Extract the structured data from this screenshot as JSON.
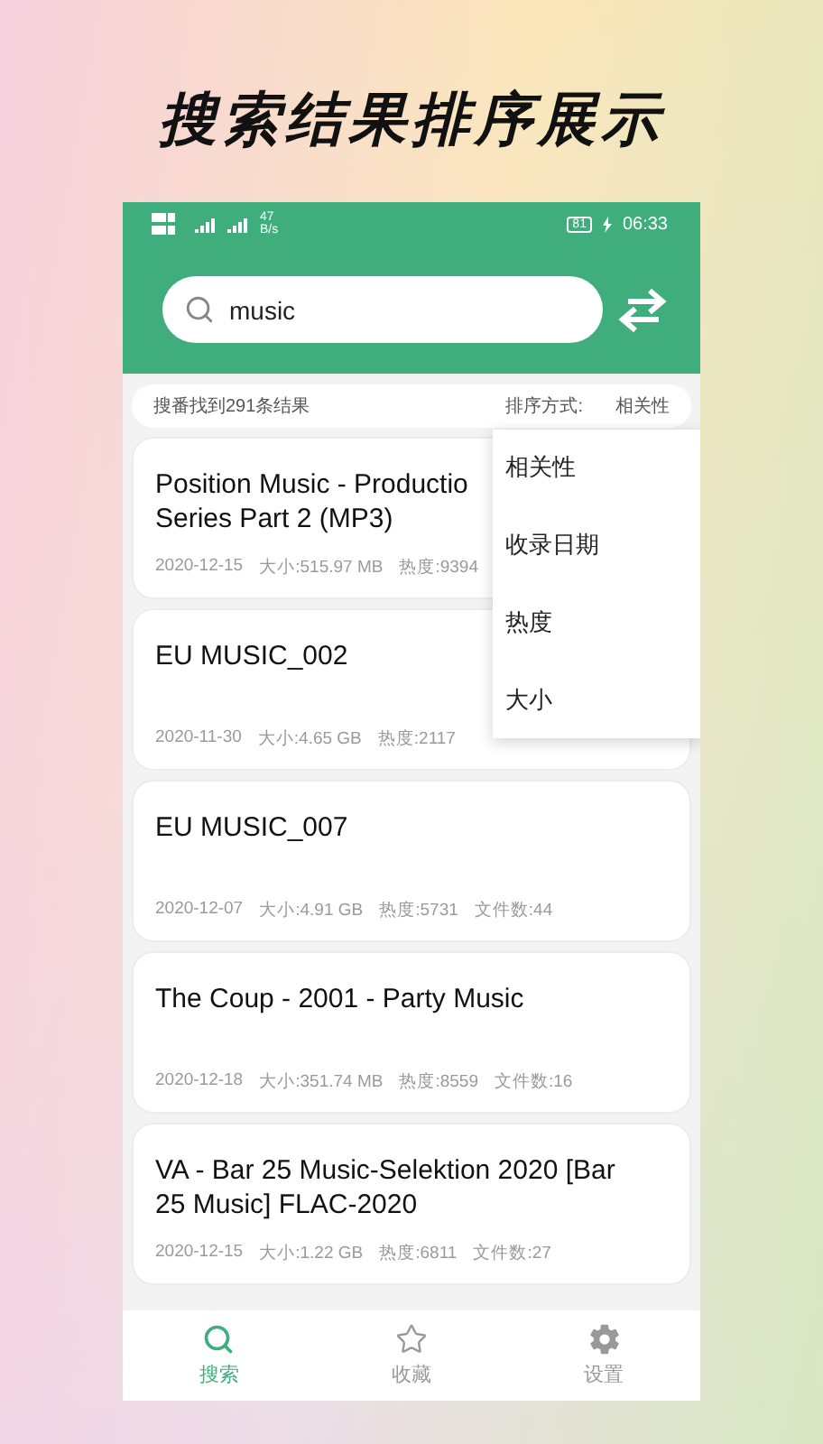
{
  "headline": "搜索结果排序展示",
  "status_bar": {
    "speed": "47",
    "speed_unit": "B/s",
    "battery": "81",
    "time": "06:33"
  },
  "search": {
    "value": "music"
  },
  "summary": {
    "count": "搜番找到291条结果",
    "sort_label": "排序方式:",
    "sort_value": "相关性"
  },
  "results": [
    {
      "title_lines": [
        "Position Music - Productio",
        "Series Part 2 (MP3)"
      ],
      "date": "2020-12-15",
      "size": "大小:515.97 MB",
      "heat": "热度:9394"
    },
    {
      "title_lines": [
        "EU MUSIC_002"
      ],
      "date": "2020-11-30",
      "size": "大小:4.65 GB",
      "heat": "热度:2117"
    },
    {
      "title_lines": [
        "EU MUSIC_007"
      ],
      "date": "2020-12-07",
      "size": "大小:4.91 GB",
      "heat": "热度:5731",
      "files": "文件数:44"
    },
    {
      "title_lines": [
        "The Coup - 2001 - Party Music"
      ],
      "date": "2020-12-18",
      "size": "大小:351.74 MB",
      "heat": "热度:8559",
      "files": "文件数:16"
    },
    {
      "title_lines": [
        "VA - Bar 25 Music-Selektion 2020 [Bar",
        "25 Music] FLAC-2020"
      ],
      "date": "2020-12-15",
      "size": "大小:1.22 GB",
      "heat": "热度:6811",
      "files": "文件数:27"
    }
  ],
  "sort_menu": [
    "相关性",
    "收录日期",
    "热度",
    "大小"
  ],
  "tabs": [
    {
      "label": "搜索",
      "kind": "search",
      "selected": true
    },
    {
      "label": "收藏",
      "kind": "favorites",
      "selected": false
    },
    {
      "label": "设置",
      "kind": "settings",
      "selected": false
    }
  ]
}
